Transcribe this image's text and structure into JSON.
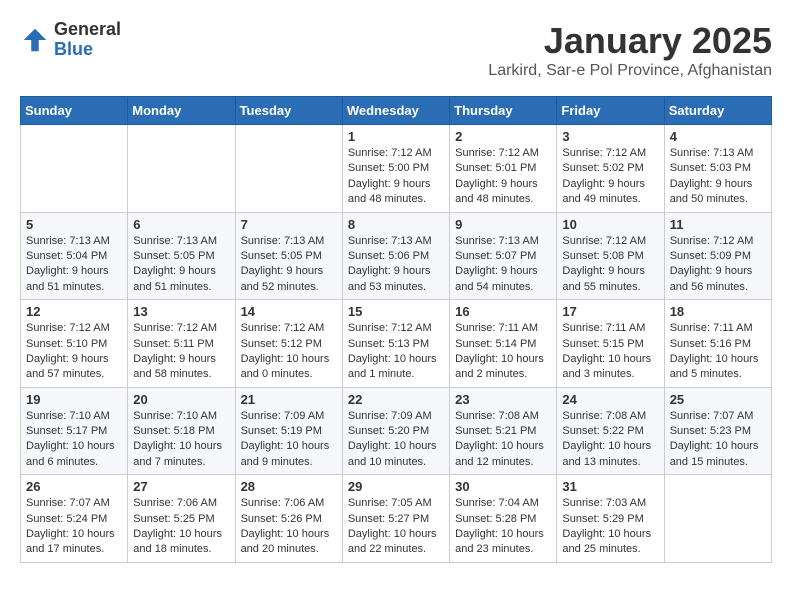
{
  "logo": {
    "general": "General",
    "blue": "Blue"
  },
  "title": "January 2025",
  "location": "Larkird, Sar-e Pol Province, Afghanistan",
  "days_of_week": [
    "Sunday",
    "Monday",
    "Tuesday",
    "Wednesday",
    "Thursday",
    "Friday",
    "Saturday"
  ],
  "weeks": [
    [
      {
        "day": "",
        "info": ""
      },
      {
        "day": "",
        "info": ""
      },
      {
        "day": "",
        "info": ""
      },
      {
        "day": "1",
        "info": "Sunrise: 7:12 AM\nSunset: 5:00 PM\nDaylight: 9 hours and 48 minutes."
      },
      {
        "day": "2",
        "info": "Sunrise: 7:12 AM\nSunset: 5:01 PM\nDaylight: 9 hours and 48 minutes."
      },
      {
        "day": "3",
        "info": "Sunrise: 7:12 AM\nSunset: 5:02 PM\nDaylight: 9 hours and 49 minutes."
      },
      {
        "day": "4",
        "info": "Sunrise: 7:13 AM\nSunset: 5:03 PM\nDaylight: 9 hours and 50 minutes."
      }
    ],
    [
      {
        "day": "5",
        "info": "Sunrise: 7:13 AM\nSunset: 5:04 PM\nDaylight: 9 hours and 51 minutes."
      },
      {
        "day": "6",
        "info": "Sunrise: 7:13 AM\nSunset: 5:05 PM\nDaylight: 9 hours and 51 minutes."
      },
      {
        "day": "7",
        "info": "Sunrise: 7:13 AM\nSunset: 5:05 PM\nDaylight: 9 hours and 52 minutes."
      },
      {
        "day": "8",
        "info": "Sunrise: 7:13 AM\nSunset: 5:06 PM\nDaylight: 9 hours and 53 minutes."
      },
      {
        "day": "9",
        "info": "Sunrise: 7:13 AM\nSunset: 5:07 PM\nDaylight: 9 hours and 54 minutes."
      },
      {
        "day": "10",
        "info": "Sunrise: 7:12 AM\nSunset: 5:08 PM\nDaylight: 9 hours and 55 minutes."
      },
      {
        "day": "11",
        "info": "Sunrise: 7:12 AM\nSunset: 5:09 PM\nDaylight: 9 hours and 56 minutes."
      }
    ],
    [
      {
        "day": "12",
        "info": "Sunrise: 7:12 AM\nSunset: 5:10 PM\nDaylight: 9 hours and 57 minutes."
      },
      {
        "day": "13",
        "info": "Sunrise: 7:12 AM\nSunset: 5:11 PM\nDaylight: 9 hours and 58 minutes."
      },
      {
        "day": "14",
        "info": "Sunrise: 7:12 AM\nSunset: 5:12 PM\nDaylight: 10 hours and 0 minutes."
      },
      {
        "day": "15",
        "info": "Sunrise: 7:12 AM\nSunset: 5:13 PM\nDaylight: 10 hours and 1 minute."
      },
      {
        "day": "16",
        "info": "Sunrise: 7:11 AM\nSunset: 5:14 PM\nDaylight: 10 hours and 2 minutes."
      },
      {
        "day": "17",
        "info": "Sunrise: 7:11 AM\nSunset: 5:15 PM\nDaylight: 10 hours and 3 minutes."
      },
      {
        "day": "18",
        "info": "Sunrise: 7:11 AM\nSunset: 5:16 PM\nDaylight: 10 hours and 5 minutes."
      }
    ],
    [
      {
        "day": "19",
        "info": "Sunrise: 7:10 AM\nSunset: 5:17 PM\nDaylight: 10 hours and 6 minutes."
      },
      {
        "day": "20",
        "info": "Sunrise: 7:10 AM\nSunset: 5:18 PM\nDaylight: 10 hours and 7 minutes."
      },
      {
        "day": "21",
        "info": "Sunrise: 7:09 AM\nSunset: 5:19 PM\nDaylight: 10 hours and 9 minutes."
      },
      {
        "day": "22",
        "info": "Sunrise: 7:09 AM\nSunset: 5:20 PM\nDaylight: 10 hours and 10 minutes."
      },
      {
        "day": "23",
        "info": "Sunrise: 7:08 AM\nSunset: 5:21 PM\nDaylight: 10 hours and 12 minutes."
      },
      {
        "day": "24",
        "info": "Sunrise: 7:08 AM\nSunset: 5:22 PM\nDaylight: 10 hours and 13 minutes."
      },
      {
        "day": "25",
        "info": "Sunrise: 7:07 AM\nSunset: 5:23 PM\nDaylight: 10 hours and 15 minutes."
      }
    ],
    [
      {
        "day": "26",
        "info": "Sunrise: 7:07 AM\nSunset: 5:24 PM\nDaylight: 10 hours and 17 minutes."
      },
      {
        "day": "27",
        "info": "Sunrise: 7:06 AM\nSunset: 5:25 PM\nDaylight: 10 hours and 18 minutes."
      },
      {
        "day": "28",
        "info": "Sunrise: 7:06 AM\nSunset: 5:26 PM\nDaylight: 10 hours and 20 minutes."
      },
      {
        "day": "29",
        "info": "Sunrise: 7:05 AM\nSunset: 5:27 PM\nDaylight: 10 hours and 22 minutes."
      },
      {
        "day": "30",
        "info": "Sunrise: 7:04 AM\nSunset: 5:28 PM\nDaylight: 10 hours and 23 minutes."
      },
      {
        "day": "31",
        "info": "Sunrise: 7:03 AM\nSunset: 5:29 PM\nDaylight: 10 hours and 25 minutes."
      },
      {
        "day": "",
        "info": ""
      }
    ]
  ]
}
